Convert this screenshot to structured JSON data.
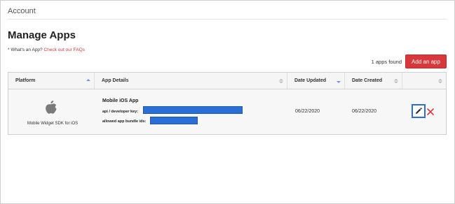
{
  "header": {
    "breadcrumb": "Account"
  },
  "page": {
    "title": "Manage Apps",
    "faq_prefix": "* What's an App?",
    "faq_link": "Check out our FAQs",
    "apps_found": "1 apps found",
    "add_button": "Add an app"
  },
  "table": {
    "columns": [
      {
        "label": "Platform",
        "sort": "asc-active"
      },
      {
        "label": "App Details",
        "sort": "none"
      },
      {
        "label": "Date Updated",
        "sort": "desc-active"
      },
      {
        "label": "Date Created",
        "sort": "none"
      },
      {
        "label": "",
        "sort": "none"
      }
    ],
    "rows": [
      {
        "platform_icon": "apple-icon",
        "platform": "Mobile Widget SDK for iOS",
        "app_name": "Mobile iOS App",
        "api_key_label": "api / developer key:",
        "bundle_ids_label": "allowed app bundle ids:",
        "date_updated": "06/22/2020",
        "date_created": "06/22/2020",
        "actions": [
          "pencil-icon",
          "close-icon"
        ]
      }
    ]
  },
  "colors": {
    "accent_red": "#d9383a",
    "redaction_blue": "#2b6fd6",
    "sort_active": "#7b8fe0"
  }
}
